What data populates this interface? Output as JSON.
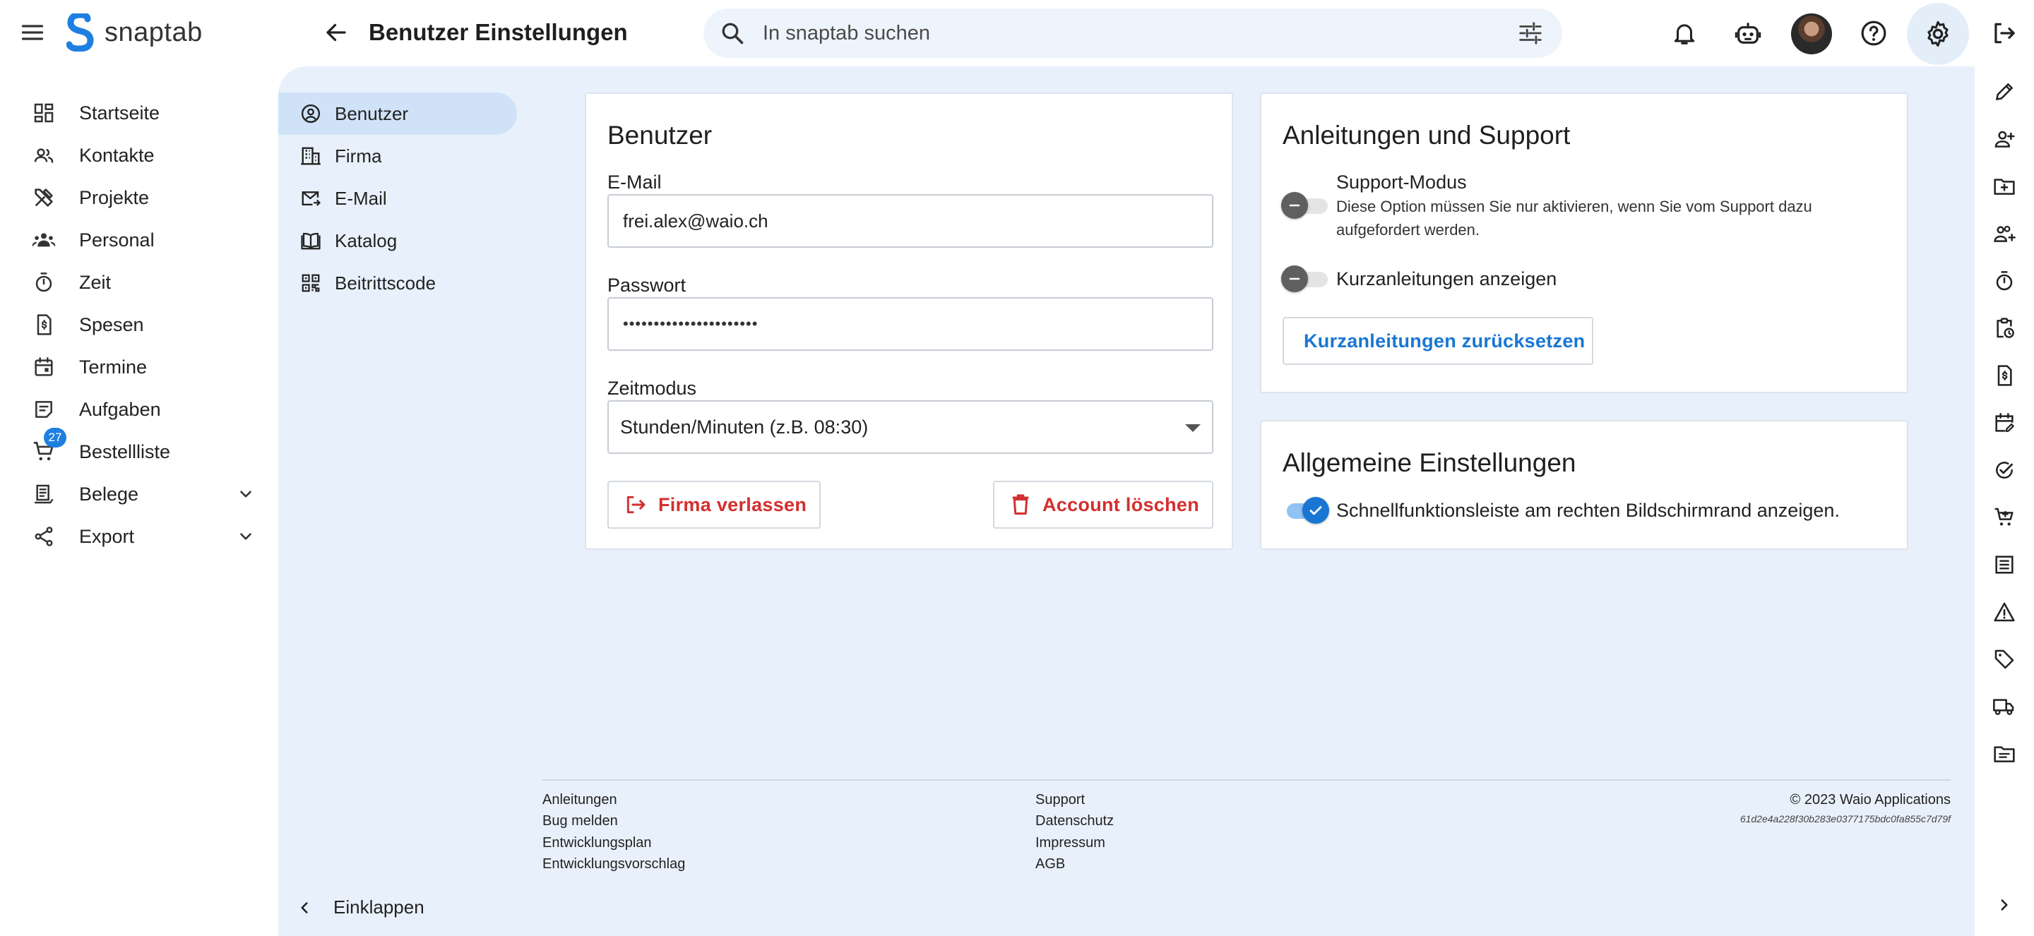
{
  "app": {
    "name": "snaptab",
    "brand_color": "#1e7fe0"
  },
  "header": {
    "title": "Benutzer Einstellungen",
    "search_placeholder": "In snaptab suchen"
  },
  "sidebar": {
    "items": [
      {
        "label": "Startseite",
        "icon": "dashboard-icon"
      },
      {
        "label": "Kontakte",
        "icon": "contacts-icon"
      },
      {
        "label": "Projekte",
        "icon": "tools-icon"
      },
      {
        "label": "Personal",
        "icon": "team-icon"
      },
      {
        "label": "Zeit",
        "icon": "timer-icon"
      },
      {
        "label": "Spesen",
        "icon": "receipt-dollar-icon"
      },
      {
        "label": "Termine",
        "icon": "calendar-icon"
      },
      {
        "label": "Aufgaben",
        "icon": "task-note-icon"
      },
      {
        "label": "Bestellliste",
        "icon": "cart-icon",
        "badge": "27"
      },
      {
        "label": "Belege",
        "icon": "receipt-icon",
        "expandable": true
      },
      {
        "label": "Export",
        "icon": "share-icon",
        "expandable": true
      }
    ],
    "collapse_label": "Einklappen"
  },
  "settings_nav": {
    "items": [
      {
        "label": "Benutzer",
        "icon": "account-circle-icon",
        "active": true
      },
      {
        "label": "Firma",
        "icon": "building-icon"
      },
      {
        "label": "E-Mail",
        "icon": "mail-icon"
      },
      {
        "label": "Katalog",
        "icon": "book-icon"
      },
      {
        "label": "Beitrittscode",
        "icon": "qr-code-icon"
      }
    ]
  },
  "user_card": {
    "title": "Benutzer",
    "email_label": "E-Mail",
    "email_value": "frei.alex@waio.ch",
    "password_label": "Passwort",
    "password_value": "••••••••••••••••••••••",
    "time_mode_label": "Zeitmodus",
    "time_mode_value": "Stunden/Minuten (z.B. 08:30)",
    "leave_company_label": "Firma verlassen",
    "delete_account_label": "Account löschen"
  },
  "support_card": {
    "title": "Anleitungen und Support",
    "support_mode_title": "Support-Modus",
    "support_mode_desc": "Diese Option müssen Sie nur aktivieren, wenn Sie vom Support dazu aufgefordert werden.",
    "support_mode_on": false,
    "quick_guides_label": "Kurzanleitungen anzeigen",
    "quick_guides_on": false,
    "reset_button_label": "Kurzanleitungen zurücksetzen"
  },
  "general_card": {
    "title": "Allgemeine Einstellungen",
    "quickbar_label": "Schnellfunktionsleiste am rechten Bildschirmrand anzeigen.",
    "quickbar_on": true
  },
  "footer": {
    "col1": [
      "Anleitungen",
      "Bug melden",
      "Entwicklungsplan",
      "Entwicklungsvorschlag"
    ],
    "col2": [
      "Support",
      "Datenschutz",
      "Impressum",
      "AGB"
    ],
    "copyright": "© 2023  Waio Applications",
    "hash": "61d2e4a228f30b283e0377175bdc0fa855c7d79f"
  }
}
